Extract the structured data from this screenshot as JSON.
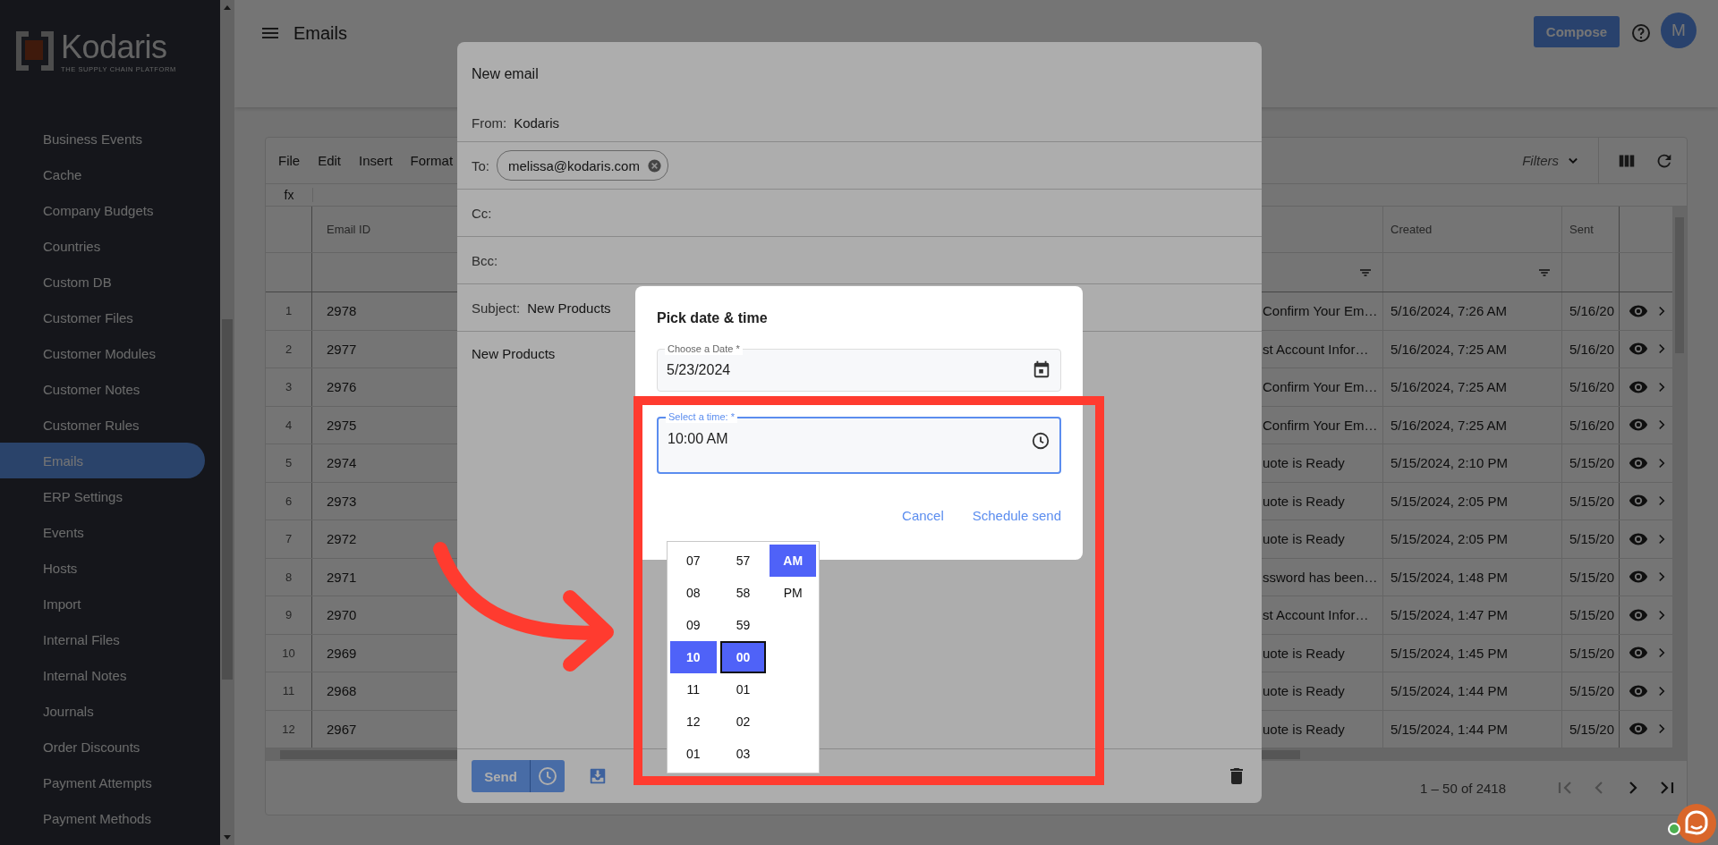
{
  "sidebar": {
    "logo": {
      "name": "Kodaris",
      "tagline": "THE SUPPLY CHAIN PLATFORM"
    },
    "items": [
      {
        "label": "Business Events",
        "selected": false
      },
      {
        "label": "Cache",
        "selected": false
      },
      {
        "label": "Company Budgets",
        "selected": false
      },
      {
        "label": "Countries",
        "selected": false
      },
      {
        "label": "Custom DB",
        "selected": false
      },
      {
        "label": "Customer Files",
        "selected": false
      },
      {
        "label": "Customer Modules",
        "selected": false
      },
      {
        "label": "Customer Notes",
        "selected": false
      },
      {
        "label": "Customer Rules",
        "selected": false
      },
      {
        "label": "Emails",
        "selected": true
      },
      {
        "label": "ERP Settings",
        "selected": false
      },
      {
        "label": "Events",
        "selected": false
      },
      {
        "label": "Hosts",
        "selected": false
      },
      {
        "label": "Import",
        "selected": false
      },
      {
        "label": "Internal Files",
        "selected": false
      },
      {
        "label": "Internal Notes",
        "selected": false
      },
      {
        "label": "Journals",
        "selected": false
      },
      {
        "label": "Order Discounts",
        "selected": false
      },
      {
        "label": "Payment Attempts",
        "selected": false
      },
      {
        "label": "Payment Methods",
        "selected": false
      }
    ]
  },
  "header": {
    "title": "Emails",
    "compose_button": "Compose",
    "avatar": "M"
  },
  "table": {
    "menu": [
      "File",
      "Edit",
      "Insert",
      "Format"
    ],
    "formula_label": "fx",
    "filters_label": "Filters",
    "columns": [
      {
        "label": "Email ID"
      },
      {
        "filter": true
      },
      {
        "label": "Created",
        "filter": true
      },
      {
        "label": "Sent",
        "filter": false
      }
    ],
    "rows": [
      {
        "number": "1",
        "email_id": "2978",
        "column_3": "Confirm Your Em…",
        "created": "5/16/2024, 7:26 AM",
        "sent": "5/16/20"
      },
      {
        "number": "2",
        "email_id": "2977",
        "column_3": "st Account Infor…",
        "created": "5/16/2024, 7:25 AM",
        "sent": "5/16/20"
      },
      {
        "number": "3",
        "email_id": "2976",
        "column_3": "Confirm Your Em…",
        "created": "5/16/2024, 7:25 AM",
        "sent": "5/16/20"
      },
      {
        "number": "4",
        "email_id": "2975",
        "column_3": "Confirm Your Em…",
        "created": "5/16/2024, 7:25 AM",
        "sent": "5/16/20"
      },
      {
        "number": "5",
        "email_id": "2974",
        "column_3": "uote is Ready",
        "created": "5/15/2024, 2:10 PM",
        "sent": "5/15/20"
      },
      {
        "number": "6",
        "email_id": "2973",
        "column_3": "uote is Ready",
        "created": "5/15/2024, 2:05 PM",
        "sent": "5/15/20"
      },
      {
        "number": "7",
        "email_id": "2972",
        "column_3": "uote is Ready",
        "created": "5/15/2024, 2:05 PM",
        "sent": "5/15/20"
      },
      {
        "number": "8",
        "email_id": "2971",
        "column_3": "ssword has been…",
        "created": "5/15/2024, 1:48 PM",
        "sent": "5/15/20"
      },
      {
        "number": "9",
        "email_id": "2970",
        "column_3": "st Account Infor…",
        "created": "5/15/2024, 1:47 PM",
        "sent": "5/15/20"
      },
      {
        "number": "10",
        "email_id": "2969",
        "column_3": "uote is Ready",
        "created": "5/15/2024, 1:45 PM",
        "sent": "5/15/20"
      },
      {
        "number": "11",
        "email_id": "2968",
        "column_3": "uote is Ready",
        "created": "5/15/2024, 1:44 PM",
        "sent": "5/15/20"
      },
      {
        "number": "12",
        "email_id": "2967",
        "column_3": "uote is Ready",
        "created": "5/15/2024, 1:44 PM",
        "sent": "5/15/20"
      }
    ],
    "pagination": "1 – 50 of 2418",
    "pager": [
      {
        "kind": "first",
        "disabled": true
      },
      {
        "kind": "previous",
        "disabled": true
      },
      {
        "kind": "next",
        "disabled": false
      },
      {
        "kind": "last",
        "disabled": false
      }
    ]
  },
  "email_dialog": {
    "title": "New email",
    "from_label": "From:",
    "from": "Kodaris",
    "to_label": "To:",
    "recipients": [
      "melissa@kodaris.com"
    ],
    "cc_label": "Cc:",
    "bcc_label": "Bcc:",
    "subject_label": "Subject:",
    "subject": "New Products",
    "body": "New Products",
    "send_button": "Send"
  },
  "date_dialog": {
    "title": "Pick date & time",
    "date_field": {
      "label": "Choose a Date *",
      "value": "5/23/2024",
      "focused": false
    },
    "time_field": {
      "label": "Select a time: *",
      "value": "10:00 AM",
      "focused": true
    },
    "cancel_button": "Cancel",
    "confirm_button": "Schedule send",
    "time_list": {
      "hours": [
        {
          "label": "07",
          "selected": false,
          "focused": false
        },
        {
          "label": "08",
          "selected": false,
          "focused": false
        },
        {
          "label": "09",
          "selected": false,
          "focused": false
        },
        {
          "label": "10",
          "selected": true,
          "focused": false
        },
        {
          "label": "11",
          "selected": false,
          "focused": false
        },
        {
          "label": "12",
          "selected": false,
          "focused": false
        },
        {
          "label": "01",
          "selected": false,
          "focused": false
        }
      ],
      "minutes": [
        {
          "label": "57",
          "selected": false,
          "focused": false
        },
        {
          "label": "58",
          "selected": false,
          "focused": false
        },
        {
          "label": "59",
          "selected": false,
          "focused": false
        },
        {
          "label": "00",
          "selected": true,
          "focused": true
        },
        {
          "label": "01",
          "selected": false,
          "focused": false
        },
        {
          "label": "02",
          "selected": false,
          "focused": false
        },
        {
          "label": "03",
          "selected": false,
          "focused": false
        }
      ],
      "periods": [
        {
          "label": "AM",
          "selected": true,
          "focused": false
        },
        {
          "label": "PM",
          "selected": false,
          "focused": false
        }
      ]
    }
  }
}
